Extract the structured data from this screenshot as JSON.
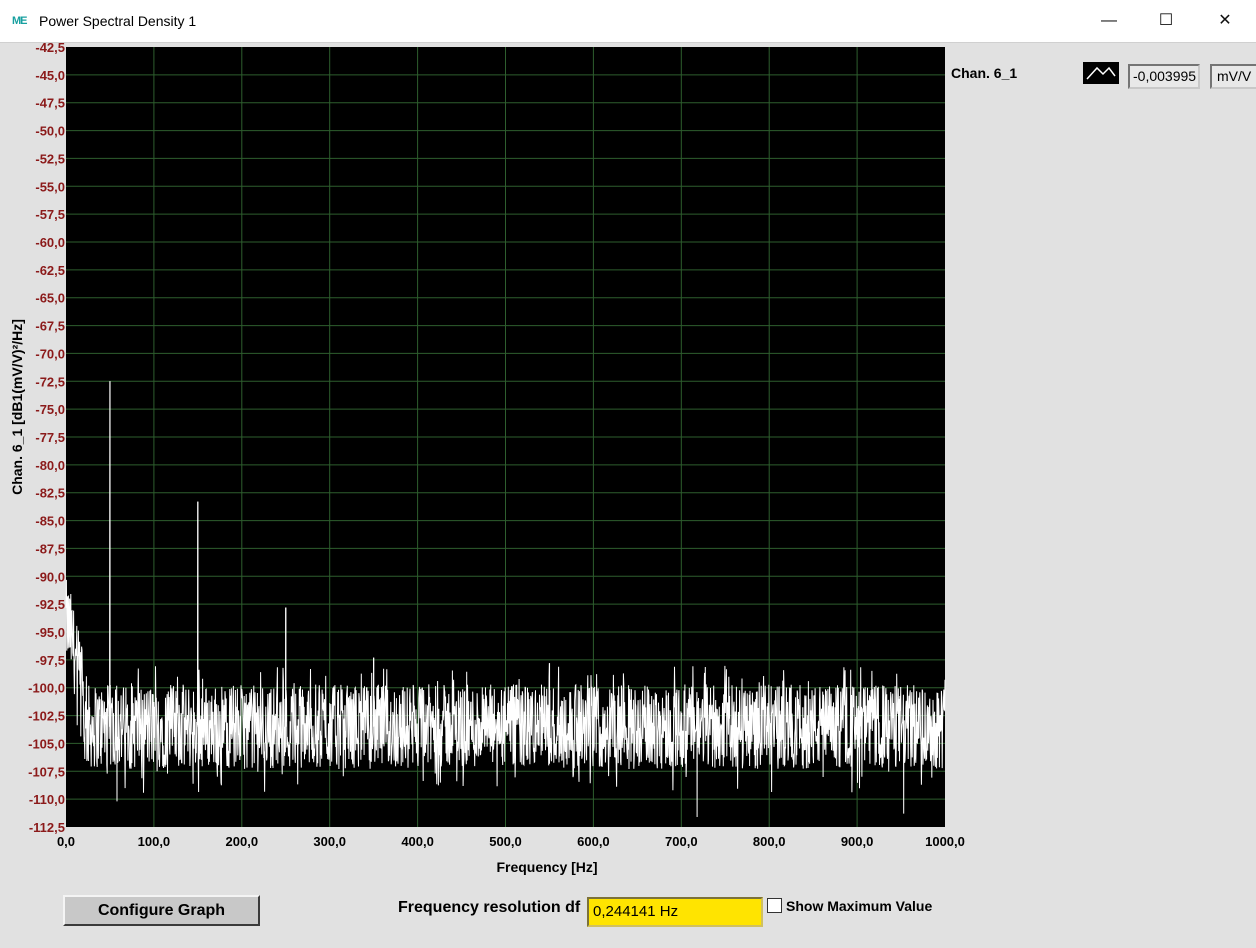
{
  "window": {
    "app_icon": "ME",
    "title": "Power Spectral Density  1",
    "minimize": "—",
    "maximize": "☐",
    "close": "✕"
  },
  "legend": {
    "channel": "Chan. 6_1",
    "value": "-0,003995",
    "unit": "mV/V"
  },
  "controls": {
    "configure_label": "Configure Graph",
    "freq_res_label": "Frequency resolution df",
    "freq_res_value": "0,244141 Hz",
    "show_max_label": "Show Maximum Value",
    "show_max_checked": false
  },
  "chart_data": {
    "type": "line",
    "title": "",
    "xlabel": "Frequency [Hz]",
    "ylabel": "Chan. 6_1 [dB1(mV/V)²/Hz]",
    "xlim": [
      0,
      1000
    ],
    "ylim": [
      -112.5,
      -42.5
    ],
    "x_ticks": [
      "0,0",
      "100,0",
      "200,0",
      "300,0",
      "400,0",
      "500,0",
      "600,0",
      "700,0",
      "800,0",
      "900,0",
      "1000,0"
    ],
    "y_ticks": [
      "-42,5",
      "-45,0",
      "-47,5",
      "-50,0",
      "-52,5",
      "-55,0",
      "-57,5",
      "-60,0",
      "-62,5",
      "-65,0",
      "-67,5",
      "-70,0",
      "-72,5",
      "-75,0",
      "-77,5",
      "-80,0",
      "-82,5",
      "-85,0",
      "-87,5",
      "-90,0",
      "-92,5",
      "-95,0",
      "-97,5",
      "-100,0",
      "-102,5",
      "-105,0",
      "-107,5",
      "-110,0",
      "-112,5"
    ],
    "grid": true,
    "background": "#000000",
    "line_color": "#ffffff",
    "grid_color": "#2e5e2e",
    "tick_label_color": "#8b1a1a",
    "series": [
      {
        "name": "Chan. 6_1",
        "noise_floor_mean": -103.5,
        "noise_floor_range": [
          -108,
          -100
        ],
        "low_freq_rise": [
          [
            0,
            -94
          ],
          [
            5,
            -95
          ],
          [
            10,
            -97
          ],
          [
            15,
            -99
          ],
          [
            20,
            -101
          ]
        ],
        "peaks": [
          {
            "x": 50,
            "y": -72.5
          },
          {
            "x": 150,
            "y": -83.3
          },
          {
            "x": 250,
            "y": -92.8
          },
          {
            "x": 350,
            "y": -97.3
          },
          {
            "x": 550,
            "y": -97.8
          }
        ],
        "dips": [
          {
            "x": 58,
            "y": -110.2
          },
          {
            "x": 718,
            "y": -111.6
          },
          {
            "x": 953,
            "y": -111.3
          }
        ]
      }
    ]
  }
}
